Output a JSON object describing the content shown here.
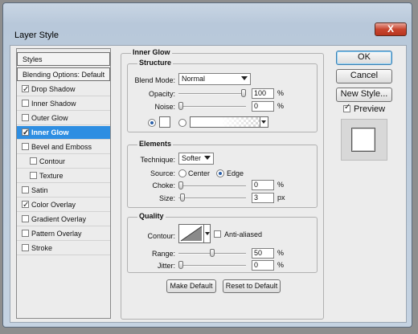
{
  "window": {
    "title": "Layer Style",
    "close_glyph": "X"
  },
  "styles_list": {
    "header": "Styles",
    "blending_options": "Blending Options: Default",
    "items": [
      {
        "label": "Drop Shadow",
        "checked": true
      },
      {
        "label": "Inner Shadow",
        "checked": false
      },
      {
        "label": "Outer Glow",
        "checked": false
      },
      {
        "label": "Inner Glow",
        "checked": true,
        "selected": true
      },
      {
        "label": "Bevel and Emboss",
        "checked": false
      },
      {
        "label": "Contour",
        "checked": false
      },
      {
        "label": "Texture",
        "checked": false
      },
      {
        "label": "Satin",
        "checked": false
      },
      {
        "label": "Color Overlay",
        "checked": true
      },
      {
        "label": "Gradient Overlay",
        "checked": false
      },
      {
        "label": "Pattern Overlay",
        "checked": false
      },
      {
        "label": "Stroke",
        "checked": false
      }
    ]
  },
  "panel": {
    "title": "Inner Glow"
  },
  "structure": {
    "title": "Structure",
    "blend_mode_label": "Blend Mode:",
    "blend_mode_value": "Normal",
    "opacity_label": "Opacity:",
    "opacity_value": "100",
    "opacity_level": 1.0,
    "noise_label": "Noise:",
    "noise_value": "0",
    "noise_level": 0.0,
    "percent": "%"
  },
  "elements": {
    "title": "Elements",
    "technique_label": "Technique:",
    "technique_value": "Softer",
    "source_label": "Source:",
    "source_center": "Center",
    "source_edge": "Edge",
    "choke_label": "Choke:",
    "choke_value": "0",
    "choke_level": 0.0,
    "size_label": "Size:",
    "size_value": "3",
    "size_level": 0.02,
    "percent": "%",
    "px": "px"
  },
  "quality": {
    "title": "Quality",
    "contour_label": "Contour:",
    "antialiased_label": "Anti-aliased",
    "range_label": "Range:",
    "range_value": "50",
    "range_level": 0.5,
    "jitter_label": "Jitter:",
    "jitter_value": "0",
    "jitter_level": 0.0,
    "percent": "%"
  },
  "buttons": {
    "make_default": "Make Default",
    "reset_default": "Reset to Default",
    "ok": "OK",
    "cancel": "Cancel",
    "new_style": "New Style...",
    "preview": "Preview"
  },
  "colors": {
    "selection": "#2e8ee2",
    "glow_swatch": "#ffffff"
  }
}
